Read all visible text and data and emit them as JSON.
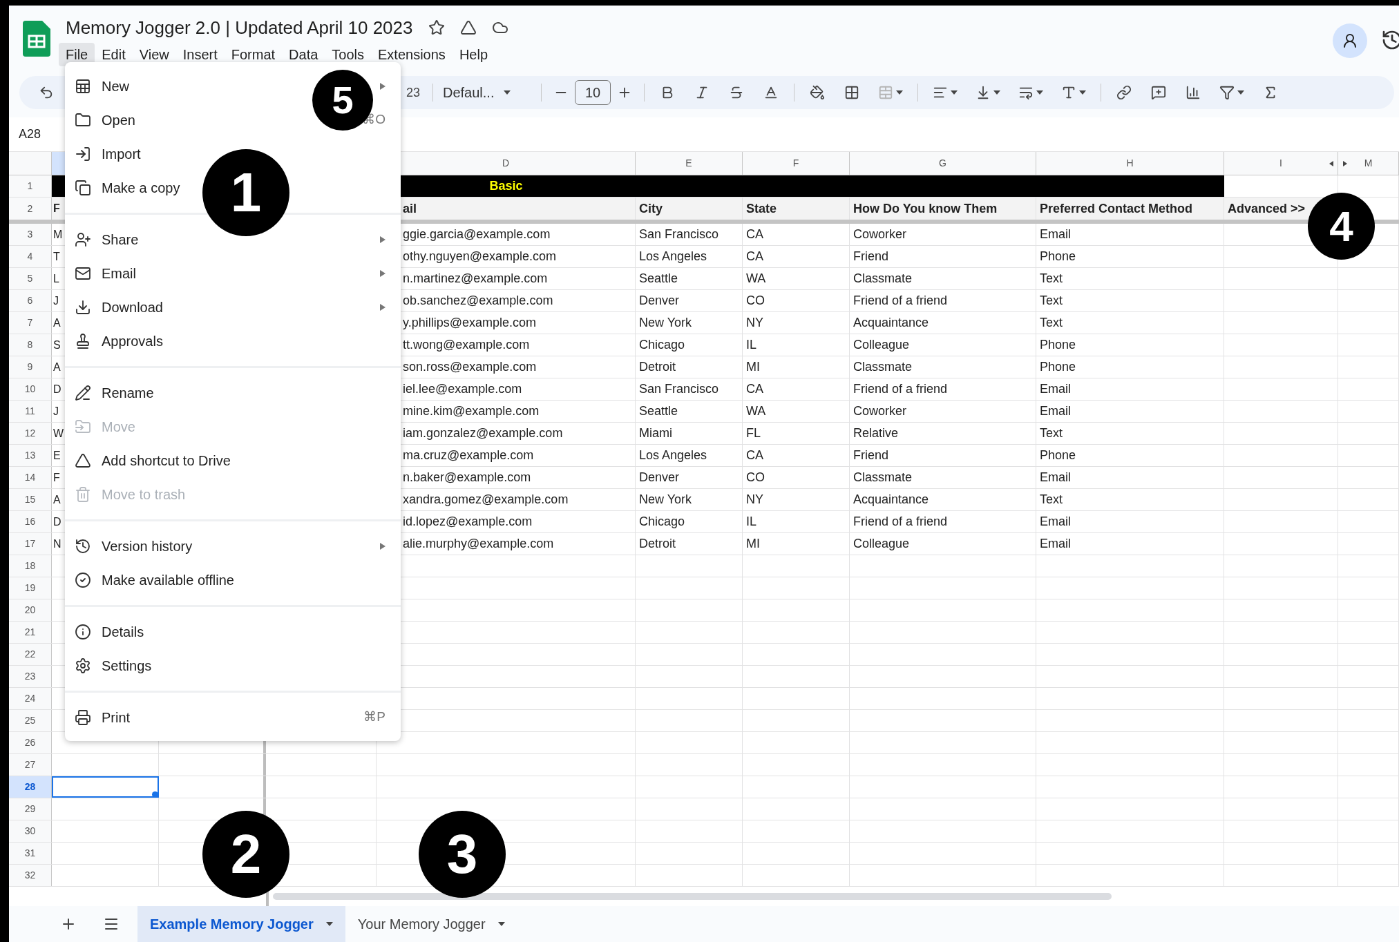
{
  "app": {
    "title": "Memory Jogger 2.0 | Updated April 10 2023",
    "menus": [
      {
        "label": "File",
        "selected": true
      },
      {
        "label": "Edit",
        "selected": false
      },
      {
        "label": "View",
        "selected": false
      },
      {
        "label": "Insert",
        "selected": false
      },
      {
        "label": "Format",
        "selected": false
      },
      {
        "label": "Data",
        "selected": false
      },
      {
        "label": "Tools",
        "selected": false
      },
      {
        "label": "Extensions",
        "selected": false
      },
      {
        "label": "Help",
        "selected": false
      }
    ]
  },
  "toolbar": {
    "number_format": "23",
    "font": "Defaul...",
    "font_size": "10"
  },
  "name_box": "A28",
  "column_letters": [
    "D",
    "E",
    "F",
    "G",
    "H",
    "I",
    "M"
  ],
  "rows": [
    {
      "number": "1",
      "kind": "banner",
      "label": "Basic",
      "selected": false
    },
    {
      "number": "2",
      "kind": "header",
      "col_a": "F",
      "cells": [
        "ail",
        "City",
        "State",
        "How Do You know Them",
        "Preferred Contact Method",
        "Advanced >>"
      ],
      "selected": false
    },
    {
      "number": "3",
      "kind": "data",
      "col_a": "M",
      "cells": [
        "ggie.garcia@example.com",
        "San Francisco",
        "CA",
        "Coworker",
        "Email"
      ],
      "selected": false
    },
    {
      "number": "4",
      "kind": "data",
      "col_a": "T",
      "cells": [
        "othy.nguyen@example.com",
        "Los Angeles",
        "CA",
        "Friend",
        "Phone"
      ],
      "selected": false
    },
    {
      "number": "5",
      "kind": "data",
      "col_a": "L",
      "cells": [
        "n.martinez@example.com",
        "Seattle",
        "WA",
        "Classmate",
        "Text"
      ],
      "selected": false
    },
    {
      "number": "6",
      "kind": "data",
      "col_a": "J",
      "cells": [
        "ob.sanchez@example.com",
        "Denver",
        "CO",
        "Friend of a friend",
        "Text"
      ],
      "selected": false
    },
    {
      "number": "7",
      "kind": "data",
      "col_a": "A",
      "cells": [
        "y.phillips@example.com",
        "New York",
        "NY",
        "Acquaintance",
        "Text"
      ],
      "selected": false
    },
    {
      "number": "8",
      "kind": "data",
      "col_a": "S",
      "cells": [
        "tt.wong@example.com",
        "Chicago",
        "IL",
        "Colleague",
        "Phone"
      ],
      "selected": false
    },
    {
      "number": "9",
      "kind": "data",
      "col_a": "A",
      "cells": [
        "son.ross@example.com",
        "Detroit",
        "MI",
        "Classmate",
        "Phone"
      ],
      "selected": false
    },
    {
      "number": "10",
      "kind": "data",
      "col_a": "D",
      "cells": [
        "iel.lee@example.com",
        "San Francisco",
        "CA",
        "Friend of a friend",
        "Email"
      ],
      "selected": false
    },
    {
      "number": "11",
      "kind": "data",
      "col_a": "J",
      "cells": [
        "mine.kim@example.com",
        "Seattle",
        "WA",
        "Coworker",
        "Email"
      ],
      "selected": false
    },
    {
      "number": "12",
      "kind": "data",
      "col_a": "W",
      "cells": [
        "iam.gonzalez@example.com",
        "Miami",
        "FL",
        "Relative",
        "Text"
      ],
      "selected": false
    },
    {
      "number": "13",
      "kind": "data",
      "col_a": "E",
      "cells": [
        "ma.cruz@example.com",
        "Los Angeles",
        "CA",
        "Friend",
        "Phone"
      ],
      "selected": false
    },
    {
      "number": "14",
      "kind": "data",
      "col_a": "F",
      "cells": [
        "n.baker@example.com",
        "Denver",
        "CO",
        "Classmate",
        "Email"
      ],
      "selected": false
    },
    {
      "number": "15",
      "kind": "data",
      "col_a": "A",
      "cells": [
        "xandra.gomez@example.com",
        "New York",
        "NY",
        "Acquaintance",
        "Text"
      ],
      "selected": false
    },
    {
      "number": "16",
      "kind": "data",
      "col_a": "D",
      "cells": [
        "id.lopez@example.com",
        "Chicago",
        "IL",
        "Friend of a friend",
        "Email"
      ],
      "selected": false
    },
    {
      "number": "17",
      "kind": "data",
      "col_a": "N",
      "cells": [
        "alie.murphy@example.com",
        "Detroit",
        "MI",
        "Colleague",
        "Email"
      ],
      "selected": false
    },
    {
      "number": "18",
      "kind": "empty",
      "selected": false
    },
    {
      "number": "19",
      "kind": "empty",
      "selected": false
    },
    {
      "number": "20",
      "kind": "empty",
      "selected": false
    },
    {
      "number": "21",
      "kind": "empty",
      "selected": false
    },
    {
      "number": "22",
      "kind": "empty",
      "selected": false
    },
    {
      "number": "23",
      "kind": "empty",
      "selected": false
    },
    {
      "number": "24",
      "kind": "empty",
      "selected": false
    },
    {
      "number": "25",
      "kind": "empty",
      "selected": false
    },
    {
      "number": "26",
      "kind": "empty",
      "selected": false
    },
    {
      "number": "27",
      "kind": "empty",
      "selected": false
    },
    {
      "number": "28",
      "kind": "empty",
      "selected": true
    },
    {
      "number": "29",
      "kind": "empty",
      "selected": false
    },
    {
      "number": "30",
      "kind": "empty",
      "selected": false
    },
    {
      "number": "31",
      "kind": "empty",
      "selected": false
    },
    {
      "number": "32",
      "kind": "empty",
      "selected": false
    }
  ],
  "file_menu": [
    {
      "kind": "item",
      "label": "New",
      "submenu": true,
      "disabled": false
    },
    {
      "kind": "item",
      "label": "Open",
      "shortcut": "⌘O",
      "disabled": false
    },
    {
      "kind": "item",
      "label": "Import",
      "disabled": false
    },
    {
      "kind": "item",
      "label": "Make a copy",
      "disabled": false
    },
    {
      "kind": "divider"
    },
    {
      "kind": "item",
      "label": "Share",
      "submenu": true,
      "disabled": false
    },
    {
      "kind": "item",
      "label": "Email",
      "submenu": true,
      "disabled": false
    },
    {
      "kind": "item",
      "label": "Download",
      "submenu": true,
      "disabled": false
    },
    {
      "kind": "item",
      "label": "Approvals",
      "disabled": false
    },
    {
      "kind": "divider"
    },
    {
      "kind": "item",
      "label": "Rename",
      "disabled": false
    },
    {
      "kind": "item",
      "label": "Move",
      "disabled": true
    },
    {
      "kind": "item",
      "label": "Add shortcut to Drive",
      "disabled": false
    },
    {
      "kind": "item",
      "label": "Move to trash",
      "disabled": true
    },
    {
      "kind": "divider"
    },
    {
      "kind": "item",
      "label": "Version history",
      "submenu": true,
      "disabled": false
    },
    {
      "kind": "item",
      "label": "Make available offline",
      "disabled": false
    },
    {
      "kind": "divider"
    },
    {
      "kind": "item",
      "label": "Details",
      "disabled": false
    },
    {
      "kind": "item",
      "label": "Settings",
      "disabled": false
    },
    {
      "kind": "divider"
    },
    {
      "kind": "item",
      "label": "Print",
      "shortcut": "⌘P",
      "disabled": false
    }
  ],
  "sheet_tabs": [
    {
      "label": "Example Memory Jogger",
      "selected": true
    },
    {
      "label": "Your Memory Jogger",
      "selected": false
    }
  ],
  "annotations": [
    {
      "label": "1"
    },
    {
      "label": "2"
    },
    {
      "label": "3"
    },
    {
      "label": "4"
    },
    {
      "label": "5"
    }
  ]
}
